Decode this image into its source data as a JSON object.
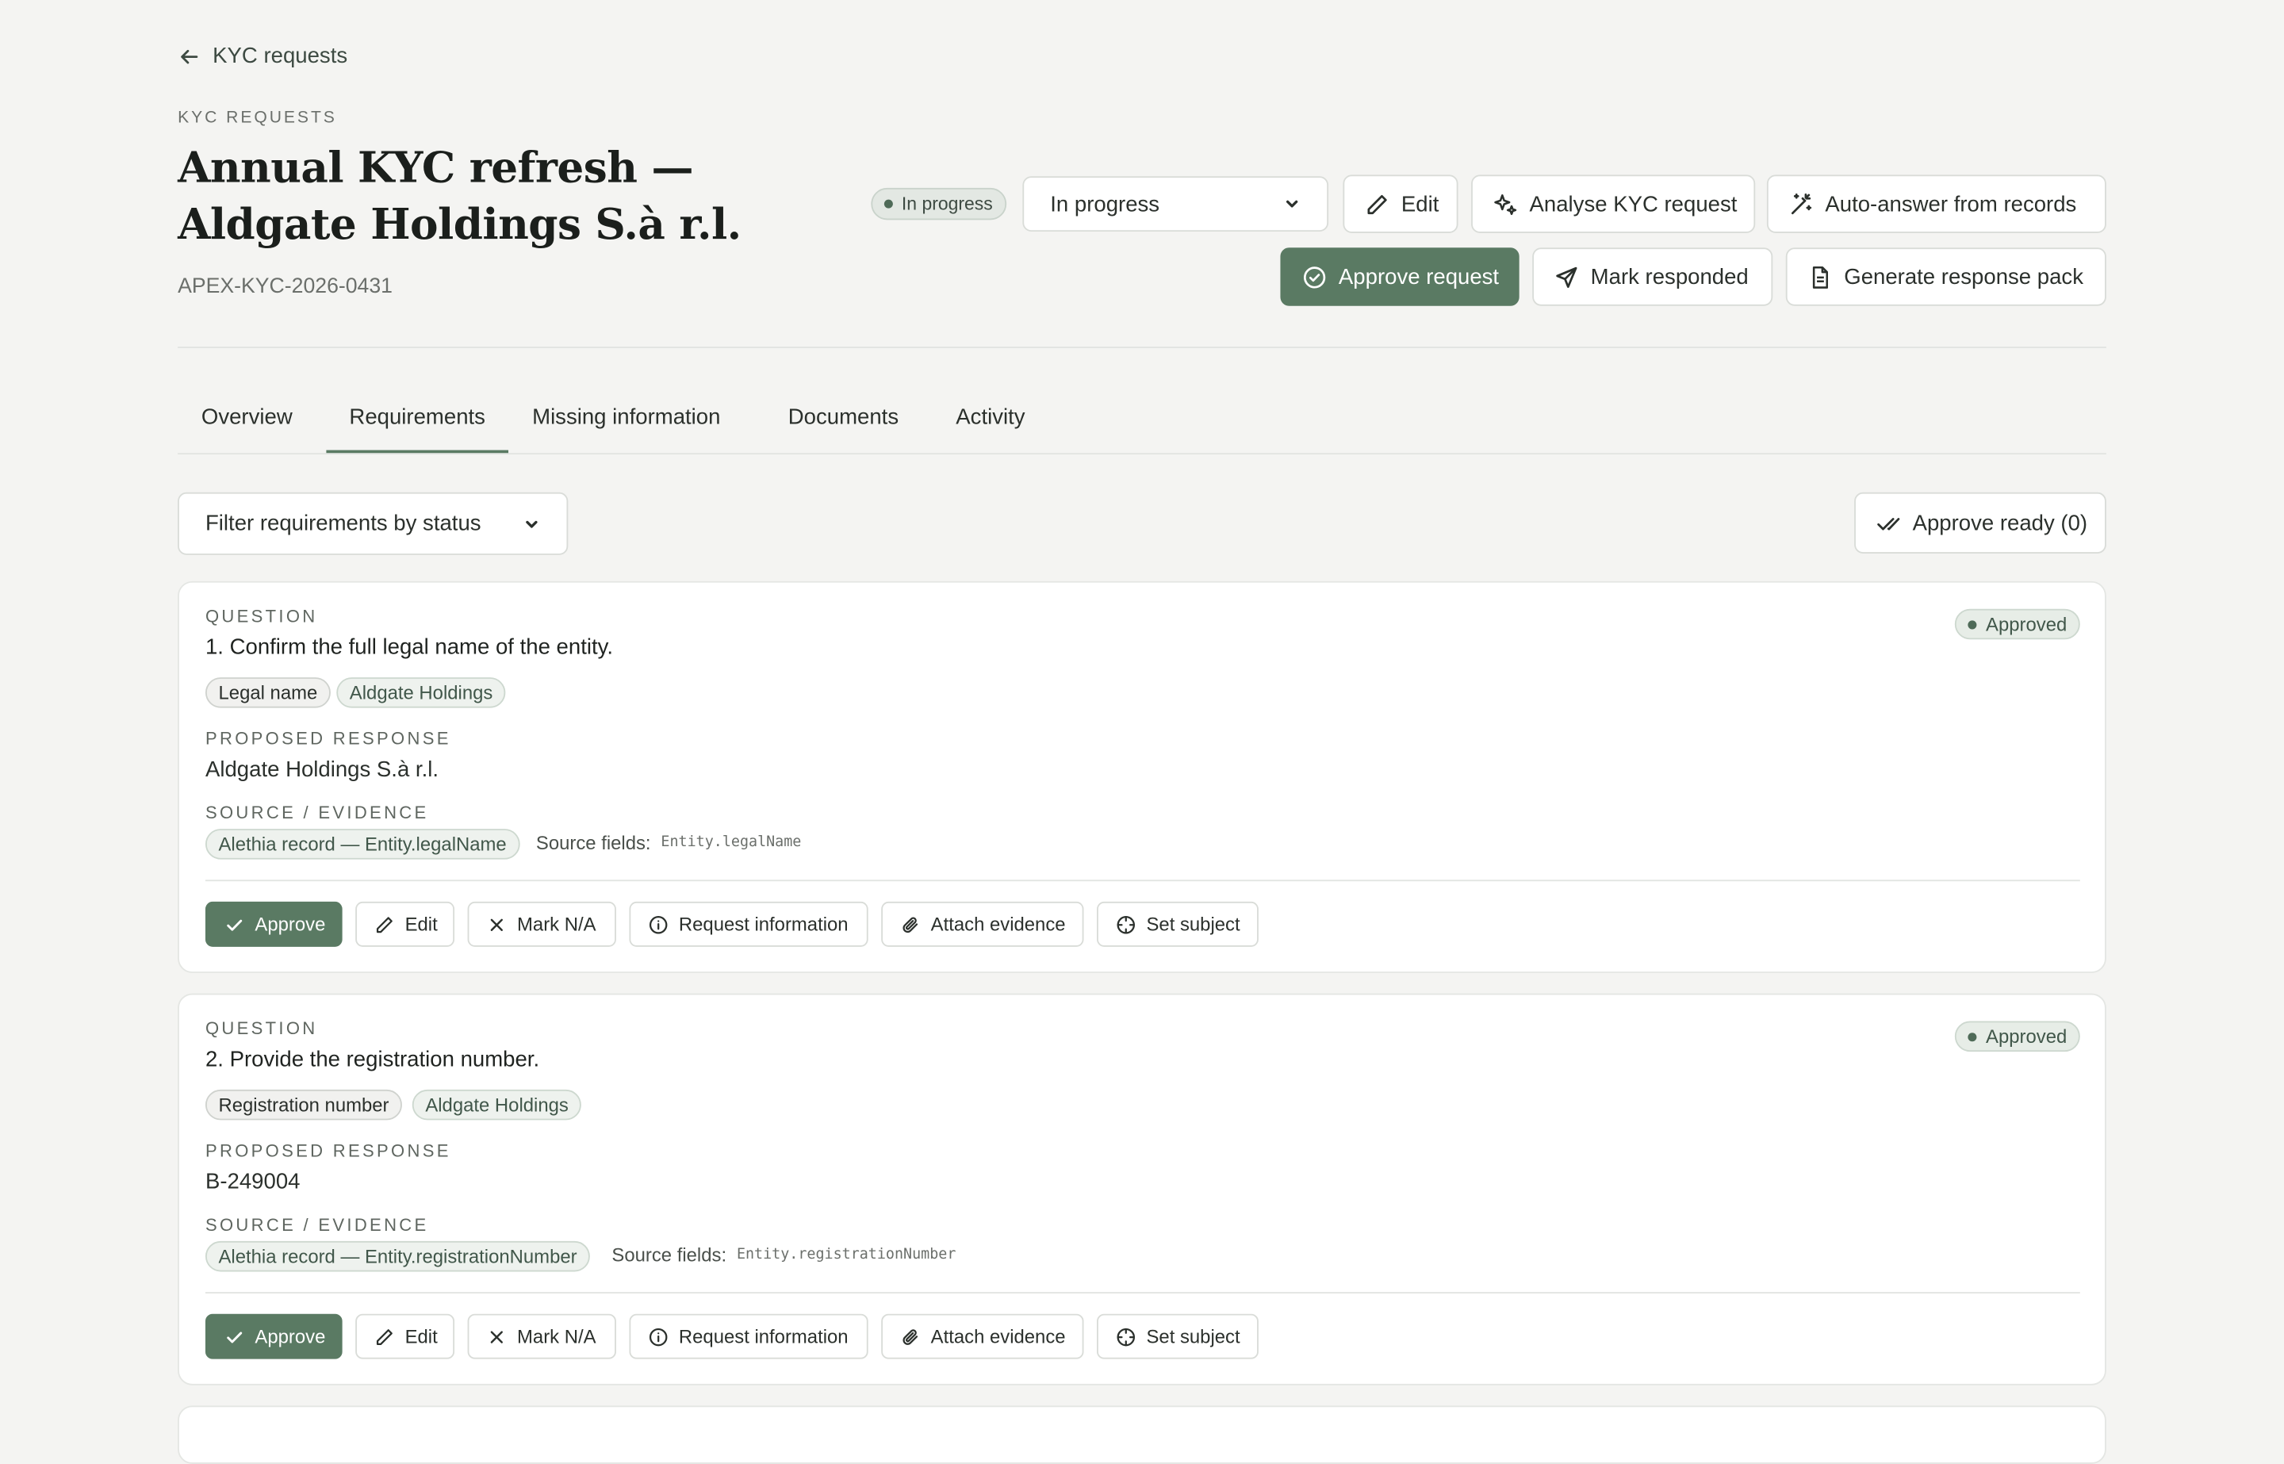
{
  "breadcrumb": {
    "back_label": "KYC requests"
  },
  "header": {
    "eyebrow": "KYC REQUESTS",
    "title": "Annual KYC refresh — Aldgate Holdings S.à r.l.",
    "reference": "APEX-KYC-2026-0431",
    "status_badge": "In progress",
    "status_select_value": "In progress",
    "buttons": {
      "edit": "Edit",
      "analyse": "Analyse KYC request",
      "auto_answer": "Auto-answer from records",
      "approve_request": "Approve request",
      "mark_responded": "Mark responded",
      "generate_pack": "Generate response pack"
    }
  },
  "tabs": [
    "Overview",
    "Requirements",
    "Missing information",
    "Documents",
    "Activity"
  ],
  "active_tab": "Requirements",
  "toolbar": {
    "filter_value": "Filter requirements by status",
    "approve_ready": "Approve ready (0)"
  },
  "labels": {
    "question": "QUESTION",
    "proposed_response": "PROPOSED RESPONSE",
    "source_evidence": "SOURCE / EVIDENCE",
    "source_fields": "Source fields:"
  },
  "actions": {
    "approve": "Approve",
    "edit": "Edit",
    "mark_na": "Mark N/A",
    "request_info": "Request information",
    "attach_evidence": "Attach evidence",
    "set_subject": "Set subject"
  },
  "requirements": [
    {
      "question": "1. Confirm the full legal name of the entity.",
      "status": "Approved",
      "tags": [
        "Legal name",
        "Aldgate Holdings"
      ],
      "response": "Aldgate Holdings S.à r.l.",
      "source": "Alethia record — Entity.legalName",
      "source_fields": "Entity.legalName"
    },
    {
      "question": "2. Provide the registration number.",
      "status": "Approved",
      "tags": [
        "Registration number",
        "Aldgate Holdings"
      ],
      "response": "B-249004",
      "source": "Alethia record — Entity.registrationNumber",
      "source_fields": "Entity.registrationNumber"
    }
  ],
  "colors": {
    "accent": "#5a7a63",
    "background": "#f4f4f2",
    "badge_bg": "#e7ede7"
  }
}
